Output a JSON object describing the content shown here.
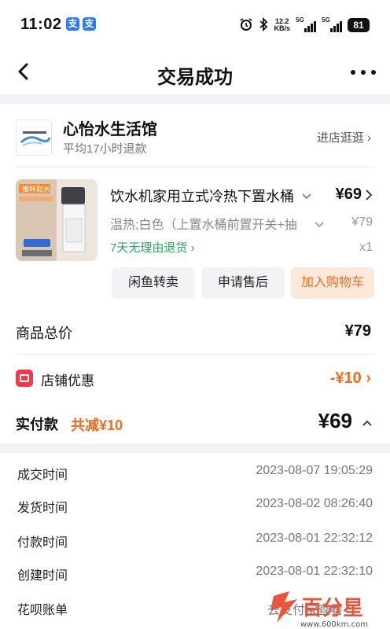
{
  "status_bar": {
    "time": "11:02",
    "app_badges": [
      "支",
      "支"
    ],
    "net_speed": "12.2",
    "net_unit": "KB/s",
    "signal_labels": [
      "5G",
      "5G"
    ],
    "battery": "81"
  },
  "nav": {
    "title": "交易成功"
  },
  "shop": {
    "name": "心怡水生活馆",
    "subtitle": "平均17小时退款",
    "link": "进店逛逛 ›"
  },
  "product": {
    "title": "饮水机家用立式冷热下置水桶",
    "price": "¥69",
    "spec": "温热;白色（上置水桶前置开关+抽",
    "original_price": "¥79",
    "tag": "7天无理由退货 ›",
    "quantity": "x1",
    "image_caption": "推杯取水",
    "image_caption_small": "前置开关 下置水桶"
  },
  "actions": {
    "resell": "闲鱼转卖",
    "after_sales": "申请售后",
    "add_cart": "加入购物车"
  },
  "price": {
    "total_label": "商品总价",
    "total_value": "¥79",
    "discount_label": "店铺优惠",
    "discount_value": "-¥10 ›",
    "paid_label": "实付款",
    "paid_saving": "共减¥10",
    "paid_value": "¥69"
  },
  "info": [
    {
      "label": "成交时间",
      "value": "2023-08-07 19:05:29"
    },
    {
      "label": "发货时间",
      "value": "2023-08-02 08:26:40"
    },
    {
      "label": "付款时间",
      "value": "2023-08-01 22:32:12"
    },
    {
      "label": "创建时间",
      "value": "2023-08-01 22:32:10"
    },
    {
      "label": "花呗账单",
      "value": "去支付宝查看"
    }
  ],
  "watermark": {
    "text": "百分星",
    "url": "www.600km.com"
  },
  "colors": {
    "accent_orange": "#ec6d21",
    "green_tag": "#27a85a",
    "coupon_red": "#ef3b4b"
  }
}
